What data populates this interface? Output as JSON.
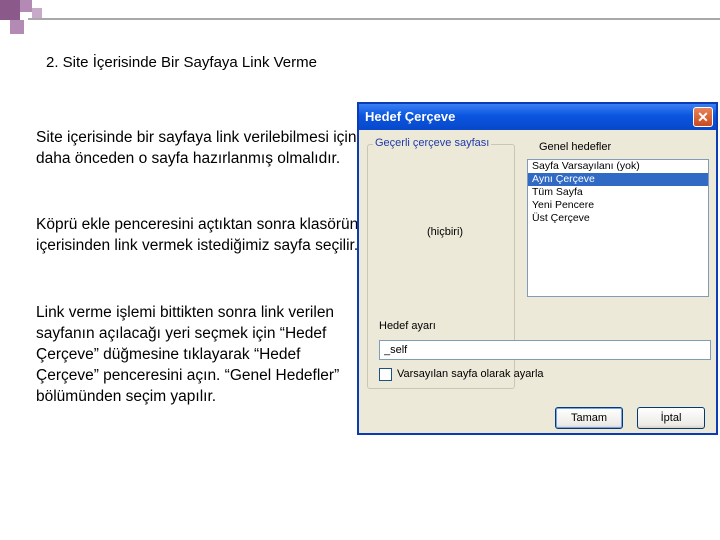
{
  "slide": {
    "title": "2. Site İçerisinde Bir Sayfaya Link Verme",
    "paragraphs": [
      "Site içerisinde bir sayfaya link verilebilmesi için daha önceden o sayfa hazırlanmış olmalıdır.",
      "Köprü ekle penceresini açtıktan sonra klasörün içerisinden link vermek istediğimiz sayfa seçilir.",
      "Link verme işlemi bittikten sonra link verilen sayfanın açılacağı yeri seçmek için “Hedef Çerçeve” düğmesine tıklayarak “Hedef Çerçeve” penceresini açın. “Genel Hedefler” bölümünden seçim yapılır."
    ]
  },
  "dialog": {
    "title": "Hedef Çerçeve",
    "close_symbol": "✕",
    "current_frame_label": "Geçerli çerçeve sayfası",
    "current_frame_value": "(hiçbiri)",
    "common_targets_label": "Genel hedefler",
    "common_targets": [
      "Sayfa Varsayılanı (yok)",
      "Aynı Çerçeve",
      "Tüm Sayfa",
      "Yeni Pencere",
      "Üst Çerçeve"
    ],
    "selected_target_index": 1,
    "target_setting_label": "Hedef ayarı",
    "target_setting_value": "_self",
    "default_checkbox_label": "Varsayılan sayfa olarak ayarla",
    "default_checkbox_checked": false,
    "ok_label": "Tamam",
    "cancel_label": "İptal"
  },
  "colors": {
    "titlebar": "#0a55e0",
    "selection": "#316ac5",
    "dialog_bg": "#ece9d8",
    "accent_squares": "#8c5a8a"
  }
}
